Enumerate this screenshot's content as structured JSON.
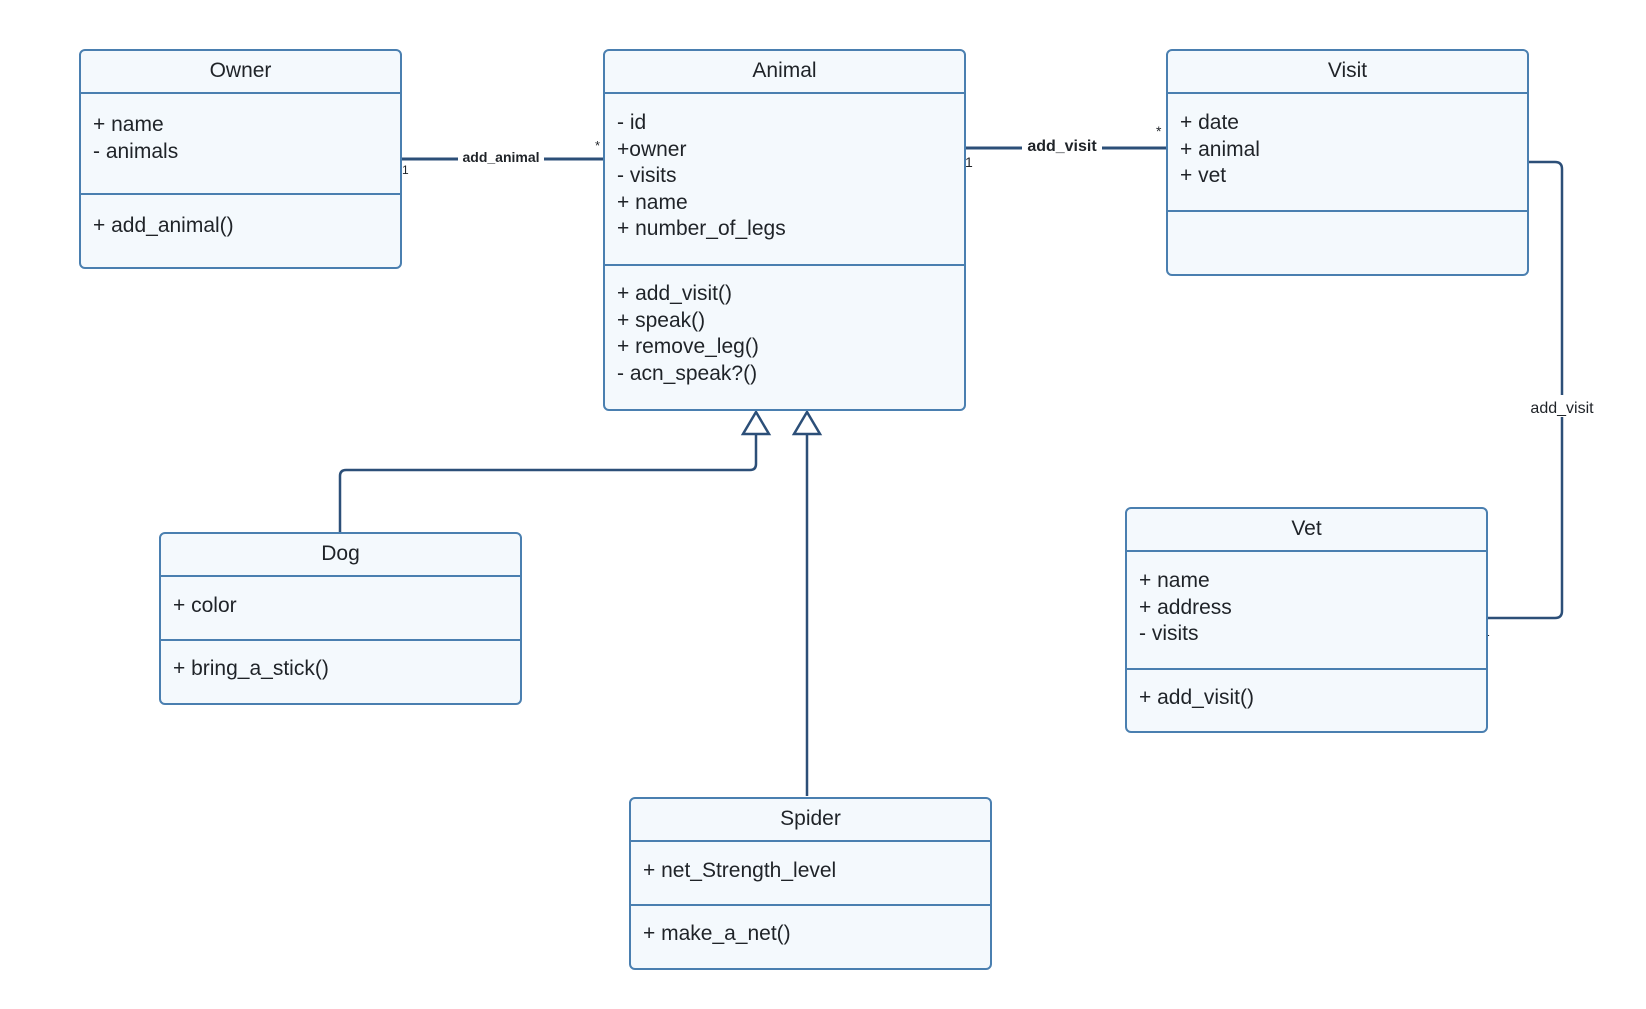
{
  "diagram": {
    "type": "UML class diagram",
    "classes": {
      "owner": {
        "name": "Owner",
        "attributes": [
          "+ name",
          "- animals"
        ],
        "methods": [
          "+ add_animal()"
        ]
      },
      "animal": {
        "name": "Animal",
        "attributes": [
          "- id",
          "+owner",
          "- visits",
          "+ name",
          "+ number_of_legs"
        ],
        "methods": [
          "+ add_visit()",
          "+ speak()",
          "+ remove_leg()",
          "- acn_speak?()"
        ]
      },
      "visit": {
        "name": "Visit",
        "attributes": [
          "+ date",
          "+ animal",
          "+ vet"
        ],
        "methods": []
      },
      "vet": {
        "name": "Vet",
        "attributes": [
          "+ name",
          "+ address",
          "- visits"
        ],
        "methods": [
          "+ add_visit()"
        ]
      },
      "dog": {
        "name": "Dog",
        "attributes": [
          "+ color"
        ],
        "methods": [
          "+ bring_a_stick()"
        ]
      },
      "spider": {
        "name": "Spider",
        "attributes": [
          "+ net_Strength_level"
        ],
        "methods": [
          "+ make_a_net()"
        ]
      }
    },
    "associations": {
      "owner_animal": {
        "label": "add_animal",
        "source_multiplicity": "1",
        "target_multiplicity": "*"
      },
      "animal_visit": {
        "label": "add_visit",
        "source_multiplicity": "1",
        "target_multiplicity": "*"
      },
      "visit_vet": {
        "label": "add_visit",
        "source_multiplicity": "*",
        "target_multiplicity": "1"
      }
    },
    "generalizations": [
      {
        "child": "Dog",
        "parent": "Animal"
      },
      {
        "child": "Spider",
        "parent": "Animal"
      }
    ],
    "colors": {
      "box_border": "#4a7fb0",
      "box_fill": "#f4f9fd",
      "connector": "#2c4f78",
      "text": "#1f2328"
    }
  }
}
